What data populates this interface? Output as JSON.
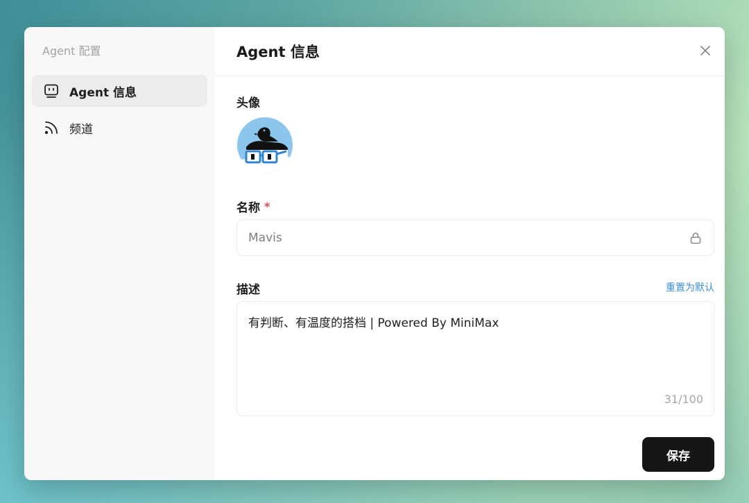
{
  "sidebar": {
    "title": "Agent 配置",
    "items": [
      {
        "label": "Agent 信息",
        "icon": "robot-icon",
        "active": true
      },
      {
        "label": "频道",
        "icon": "rss-icon",
        "active": false
      }
    ]
  },
  "header": {
    "title": "Agent 信息",
    "close_icon": "close-icon"
  },
  "form": {
    "avatar_label": "头像",
    "name_label": "名称",
    "required_mark": "*",
    "name_value": "Mavis",
    "description_label": "描述",
    "reset_link": "重置为默认",
    "description_value": "有判断、有温度的搭档 | Powered By MiniMax",
    "char_count": "31/100",
    "save_label": "保存"
  },
  "colors": {
    "accent_link": "#3d8fd6",
    "save_button": "#161616",
    "required": "#e04848"
  }
}
